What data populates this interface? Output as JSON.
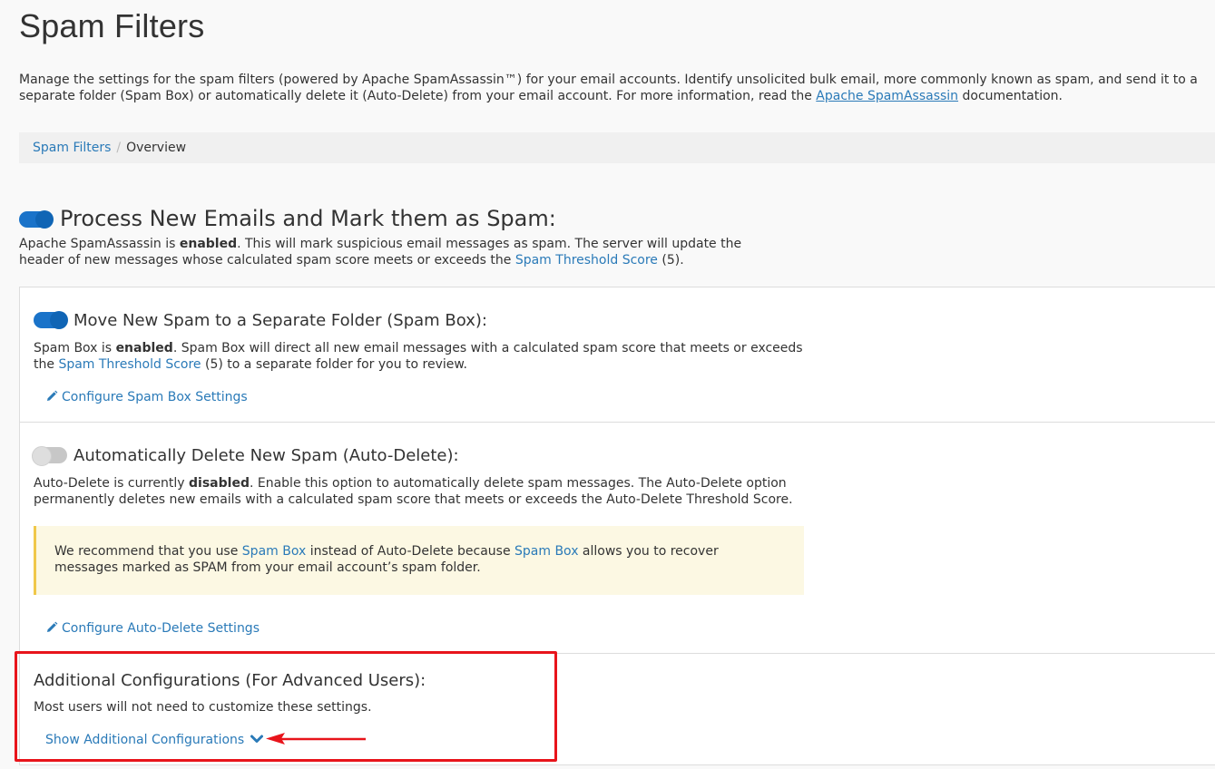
{
  "page": {
    "title": "Spam Filters",
    "intro_before": "Manage the settings for the spam filters (powered by Apache SpamAssassin™) for your email accounts. Identify unsolicited bulk email, more commonly known as spam, and send it to a separate folder (Spam Box) or automatically delete it (Auto-Delete) from your email account. For more information, read the ",
    "intro_link": "Apache SpamAssassin",
    "intro_after": " documentation."
  },
  "breadcrumb": {
    "parent": "Spam Filters",
    "separator": "/",
    "current": "Overview"
  },
  "process": {
    "toggle_state": "on",
    "heading": "Process New Emails and Mark them as Spam:",
    "desc_before": "Apache SpamAssassin is ",
    "desc_bold": "enabled",
    "desc_mid": ". This will mark suspicious email messages as spam. The server will update the header of new messages whose calculated spam score meets or exceeds the ",
    "desc_link": "Spam Threshold Score",
    "desc_after": " (5)."
  },
  "spambox": {
    "toggle_state": "on",
    "heading": "Move New Spam to a Separate Folder (Spam Box):",
    "desc_before": "Spam Box is ",
    "desc_bold": "enabled",
    "desc_mid": ". Spam Box will direct all new email messages with a calculated spam score that meets or exceeds the ",
    "desc_link": "Spam Threshold Score",
    "desc_after": " (5) to a separate folder for you to review.",
    "config_link": "Configure Spam Box Settings"
  },
  "autodelete": {
    "toggle_state": "off",
    "heading": "Automatically Delete New Spam (Auto-Delete):",
    "desc_before": "Auto-Delete is currently ",
    "desc_bold": "disabled",
    "desc_after": ". Enable this option to automatically delete spam messages. The Auto-Delete option permanently deletes new emails with a calculated spam score that meets or exceeds the Auto-Delete Threshold Score.",
    "warning_before": "We recommend that you use ",
    "warning_link1": "Spam Box",
    "warning_mid": " instead of Auto-Delete because ",
    "warning_link2": "Spam Box",
    "warning_after": " allows you to recover messages marked as SPAM from your email account’s spam folder.",
    "config_link": "Configure Auto-Delete Settings"
  },
  "additional": {
    "heading": "Additional Configurations (For Advanced Users):",
    "desc": "Most users will not need to customize these settings.",
    "show_link": "Show Additional Configurations"
  },
  "colors": {
    "accent": "#1a73c9",
    "link": "#2a7ab8",
    "warning_bg": "#fcf8e3",
    "warning_border": "#f0c84a",
    "annotation_red": "#e8141b"
  },
  "icons": {
    "edit": "pencil-icon",
    "expand": "chevron-down-icon",
    "annotation": "arrow-left-icon"
  }
}
